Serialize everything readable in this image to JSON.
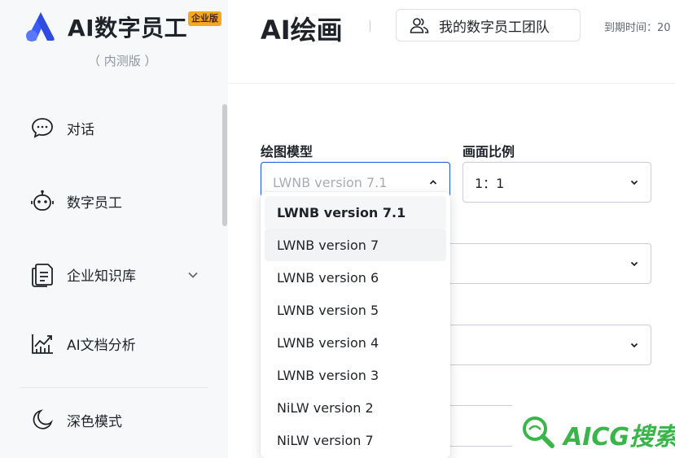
{
  "brand": {
    "title": "AI数字员工",
    "badge": "企业版",
    "subtitle": "（ 内测版 ）",
    "logo_color": "#3b5bfd"
  },
  "sidebar": {
    "items": [
      {
        "label": "对话",
        "icon": "chat-bubble-icon"
      },
      {
        "label": "数字员工",
        "icon": "robot-icon"
      },
      {
        "label": "企业知识库",
        "icon": "document-icon",
        "expandable": true
      },
      {
        "label": "AI文档分析",
        "icon": "chart-analysis-icon"
      },
      {
        "label": "深色模式",
        "icon": "moon-icon"
      }
    ]
  },
  "header": {
    "title": "AI绘画",
    "team_button": "我的数字员工团队",
    "expiry": "到期时间：20"
  },
  "form": {
    "model": {
      "label": "绘图模型",
      "value": "LWNB version 7.1"
    },
    "ratio": {
      "label": "画面比例",
      "value": "1：1"
    }
  },
  "dropdown": {
    "options": [
      "LWNB version 7.1",
      "LWNB version 7",
      "LWNB version 6",
      "LWNB version 5",
      "LWNB version 4",
      "LWNB version 3",
      "NiLW version 2",
      "NiLW version 7"
    ],
    "selected_index": 0,
    "hover_index": 1
  },
  "watermark": {
    "text": "AICG搜索",
    "color": "#3ab54a"
  },
  "colors": {
    "accent": "#1a56db",
    "sidebar_bg": "#f7f8fa",
    "badge_bg": "#f5a623"
  }
}
